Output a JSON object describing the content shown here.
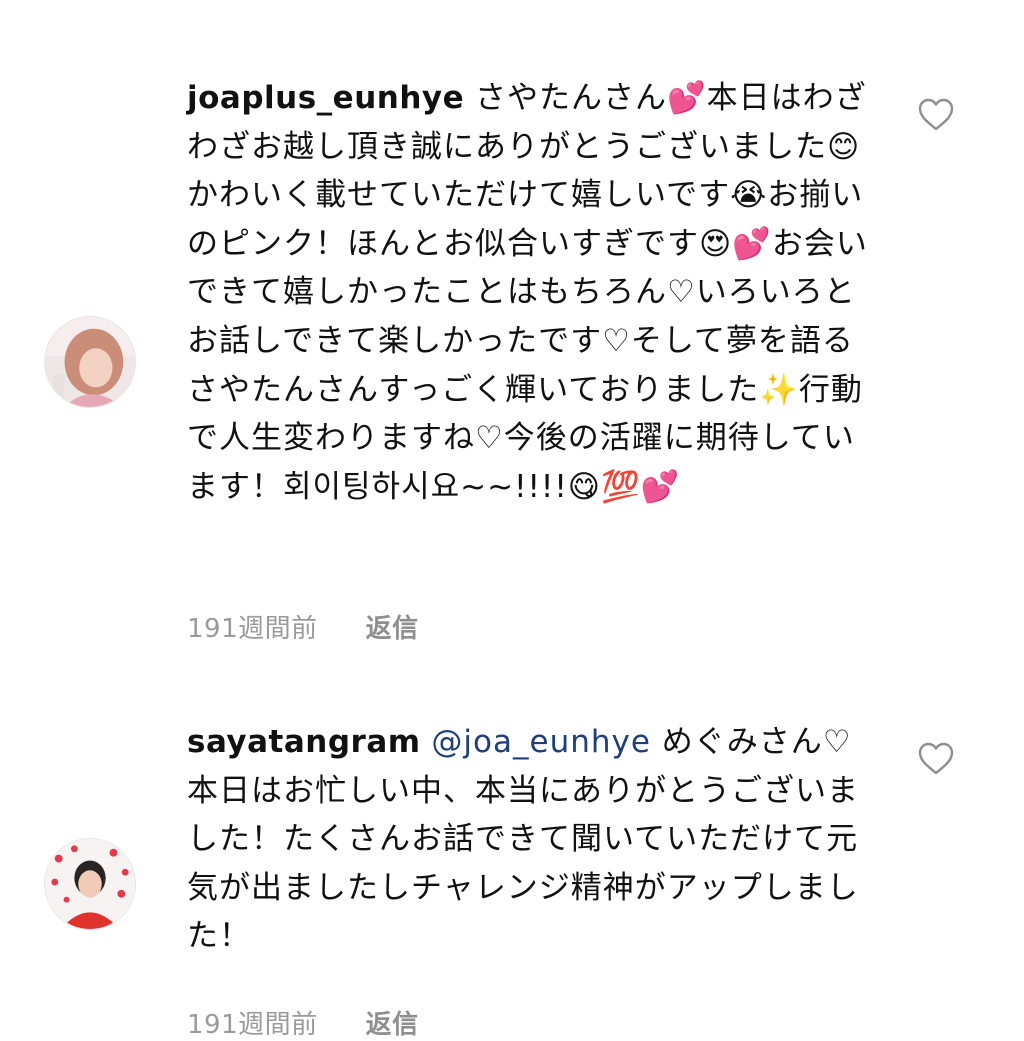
{
  "comments": [
    {
      "username": "joaplus_eunhye",
      "mention": "",
      "text": " さやたんさん💕本日はわざわざお越し頂き誠にありがとうございました😊かわいく載せていただけて嬉しいです😭お揃いのピンク！ほんとお似合いすぎです😍💕お会いできて嬉しかったことはもちろん♡いろいろとお話しできて楽しかったです♡そして夢を語るさやたんさんすっごく輝いておりました✨行動で人生変わりますね♡今後の活躍に期待しています！회이팅하시요~~!!!!😋💯💕",
      "time": "191週間前",
      "reply_label": "返信",
      "avatar_icon": "user-avatar-pink-photo"
    },
    {
      "username": "sayatangram",
      "mention": "@joa_eunhye",
      "text": " めぐみさん♡本日はお忙しい中、本当にありがとうございました！たくさんお話できて聞いていただけて元気が出ましたしチャレンジ精神がアップしました！",
      "time": "191週間前",
      "reply_label": "返信",
      "avatar_icon": "user-avatar-red-dots-photo"
    }
  ],
  "colors": {
    "mention": "#1f3f7a",
    "meta_text": "#9a9a9a",
    "heart_outline": "#8e8e8e"
  },
  "icons": {
    "like": "heart-outline-icon"
  }
}
